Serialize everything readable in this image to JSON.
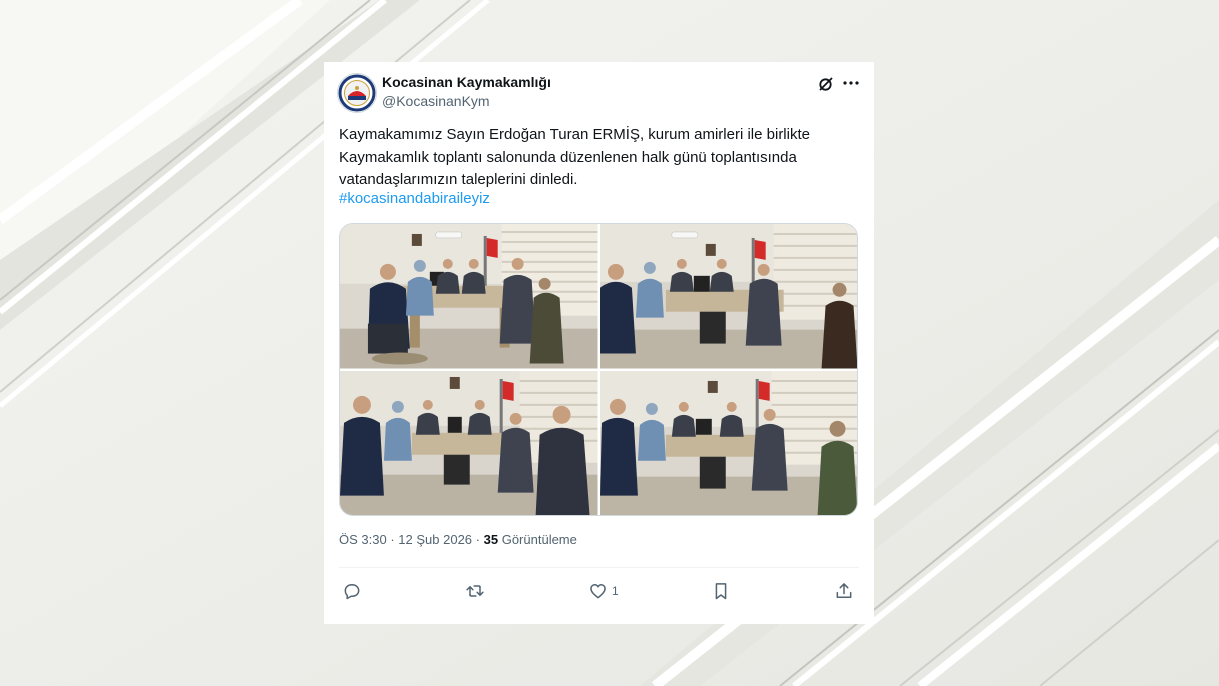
{
  "tweet": {
    "user": {
      "name": "Kocasinan Kaymakamlığı",
      "handle": "@KocasinanKym",
      "avatar_icon": "kaymakamlik-emblem-icon"
    },
    "text_lines": [
      "Kaymakamımız Sayın Erdoğan Turan ERMİŞ, kurum amirleri ile birlikte",
      "Kaymakamlık toplantı salonunda düzenlenen halk günü toplantısında",
      "vatandaşlarımızın taleplerini dinledi."
    ],
    "hashtag": "#kocasinandabiraileyiz",
    "photos": [
      {
        "icon": "meeting-photo-1"
      },
      {
        "icon": "meeting-photo-2"
      },
      {
        "icon": "meeting-photo-3"
      },
      {
        "icon": "meeting-photo-4"
      }
    ],
    "meta": {
      "time": "ÖS 3:30",
      "separator": "·",
      "date": "12 Şub 2026",
      "views_count": "35",
      "views_label": "Görüntüleme"
    },
    "actions": {
      "reply_icon": "reply-icon",
      "retweet_icon": "retweet-icon",
      "like_icon": "heart-icon",
      "like_count": "1",
      "bookmark_icon": "bookmark-icon",
      "share_icon": "share-icon"
    }
  },
  "colors": {
    "accent": "#1d9bf0",
    "text": "#0f1419",
    "muted": "#536471",
    "background": "#eeeeea",
    "card": "#ffffff"
  }
}
